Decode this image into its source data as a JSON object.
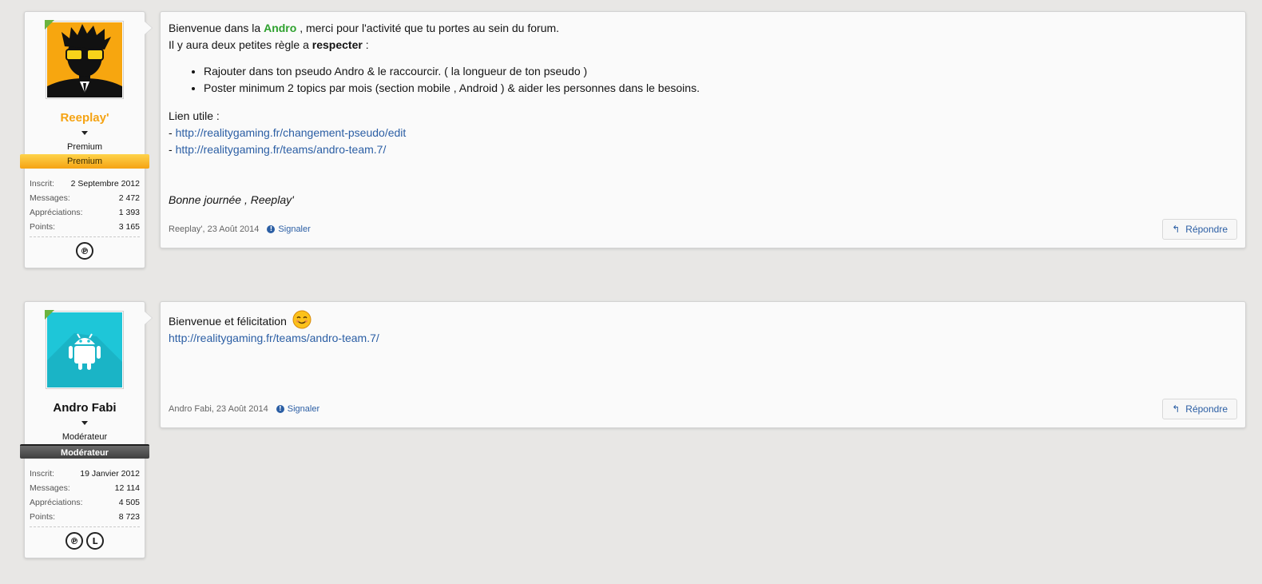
{
  "posts": [
    {
      "user": {
        "name": "Reeplay'",
        "title": "Premium",
        "banner": "Premium",
        "stats": [
          {
            "label": "Inscrit:",
            "value": "2 Septembre 2012"
          },
          {
            "label": "Messages:",
            "value": "2 472"
          },
          {
            "label": "Appréciations:",
            "value": "1 393"
          },
          {
            "label": "Points:",
            "value": "3 165"
          }
        ],
        "trophies": [
          "playstation-icon"
        ]
      },
      "body": {
        "line1_pre": "Bienvenue dans la ",
        "line1_highlight": "Andro",
        "line1_post": " , merci pour l'activité que tu portes au sein du forum.",
        "line2_pre": "Il y aura deux petites règle a ",
        "line2_bold": "respecter",
        "line2_post": " :",
        "rules": [
          "Rajouter dans ton pseudo Andro & le raccourcir. ( la longueur de ton pseudo )",
          "Poster minimum 2 topics par mois (section mobile , Android ) & aider les personnes dans le besoins."
        ],
        "links_title": "Lien utile :",
        "link_prefix": "- ",
        "links": [
          "http://realitygaming.fr/changement-pseudo/edit",
          "http://realitygaming.fr/teams/andro-team.7/"
        ],
        "signoff": "Bonne journée , Reeplay'"
      },
      "footer": {
        "meta": "Reeplay', 23 Août 2014",
        "report": "Signaler",
        "reply": "Répondre"
      }
    },
    {
      "user": {
        "name": "Andro Fabi",
        "title": "Modérateur",
        "banner": "Modérateur",
        "stats": [
          {
            "label": "Inscrit:",
            "value": "19 Janvier 2012"
          },
          {
            "label": "Messages:",
            "value": "12 114"
          },
          {
            "label": "Appréciations:",
            "value": "4 505"
          },
          {
            "label": "Points:",
            "value": "8 723"
          }
        ],
        "trophies": [
          "playstation-icon",
          "league-icon"
        ]
      },
      "body": {
        "line1": "Bienvenue et félicitation",
        "link": "http://realitygaming.fr/teams/andro-team.7/"
      },
      "footer": {
        "meta": "Andro Fabi, 23 Août 2014",
        "report": "Signaler",
        "reply": "Répondre"
      }
    }
  ],
  "icons": {
    "report": "info-icon",
    "reply": "reply-arrow-icon",
    "trophy_ps_glyph": "℗",
    "trophy_league_glyph": "L",
    "report_glyph": "!",
    "reply_glyph": "↰"
  },
  "colors": {
    "background": "#e8e7e5",
    "link": "#2b5ea4",
    "premium_name": "#f5a313",
    "andro_green": "#2ea12e",
    "online": "#6cb33e"
  }
}
